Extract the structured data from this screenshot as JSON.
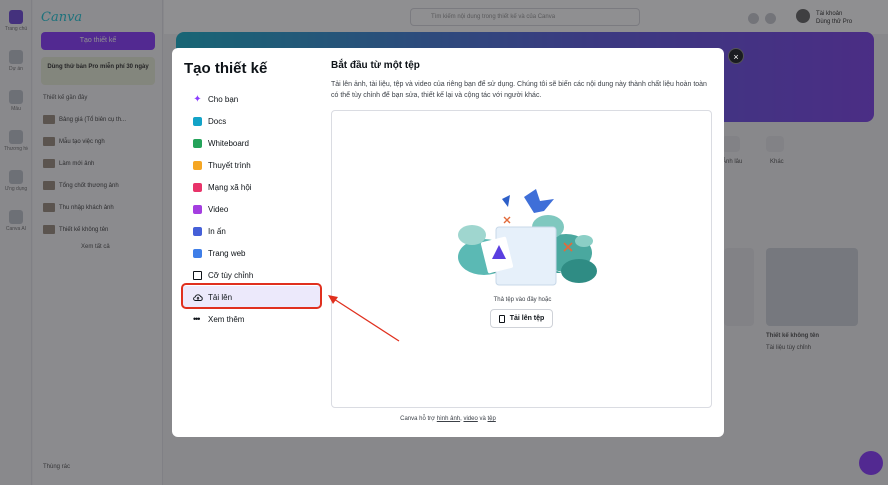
{
  "background": {
    "rail_items": [
      "Trang chủ",
      "Dự án",
      "Mẫu",
      "Thương hiệu",
      "Ứng dụng",
      "Canva AI"
    ],
    "logo": "Canva",
    "create_button": "Tạo thiết kế",
    "promo": "Dùng thử bản Pro miễn phí 30 ngày",
    "recent_title": "Thiết kế gần đây",
    "recent_items": [
      "Bảng giá (Tổ biên cụ th...",
      "Mẫu tạo việc ngh",
      "Làm mới ảnh",
      "Tổng chốt thương ảnh",
      "Thu nhập khách ảnh",
      "Thiết kế không tên"
    ],
    "see_all": "Xem tất cả",
    "trash": "Thùng rác",
    "search_placeholder": "Tìm kiếm nội dung trong thiết kế và của Canva",
    "user_name": "Tài khoản",
    "user_sub": "Dùng thử Pro",
    "shortcut_labels": [
      "Ảnh lâu",
      "Khác"
    ],
    "card_caption": "Thiết kế không tên",
    "card_sub": "Tài liệu tùy chỉnh"
  },
  "modal": {
    "title": "Tạo thiết kế",
    "nav": [
      {
        "label": "Cho bạn",
        "icon": "sparkle-icon"
      },
      {
        "label": "Docs",
        "icon": "docs-icon"
      },
      {
        "label": "Whiteboard",
        "icon": "whiteboard-icon"
      },
      {
        "label": "Thuyết trình",
        "icon": "presentation-icon"
      },
      {
        "label": "Mạng xã hội",
        "icon": "heart-icon"
      },
      {
        "label": "Video",
        "icon": "video-icon"
      },
      {
        "label": "In ấn",
        "icon": "print-icon"
      },
      {
        "label": "Trang web",
        "icon": "website-icon"
      },
      {
        "label": "Cỡ tùy chỉnh",
        "icon": "custom-size-icon"
      },
      {
        "label": "Tải lên",
        "icon": "cloud-upload-icon"
      },
      {
        "label": "Xem thêm",
        "icon": "more-icon"
      }
    ],
    "active_item": "Tải lên",
    "section_title": "Bắt đầu từ một tệp",
    "section_desc": "Tải lên ảnh, tài liệu, tệp và video của riêng bạn để sử dụng. Chúng tôi sẽ biến các nội dung này thành chất liệu hoàn toàn có thể tùy chỉnh để bạn sửa, thiết kế lại và cộng tác với người khác.",
    "drop_hint": "Thả tệp vào đây hoặc",
    "upload_button": "Tải lên tệp",
    "footer": {
      "prefix": "Canva hỗ trợ",
      "link1": "hình ảnh",
      "sep": ",",
      "link2": "video",
      "and": "và",
      "link3": "tệp"
    },
    "close": "×"
  },
  "colors": {
    "accent": "#8b3dff",
    "highlight": "#e0301e",
    "active_bg": "#ece9fb"
  }
}
